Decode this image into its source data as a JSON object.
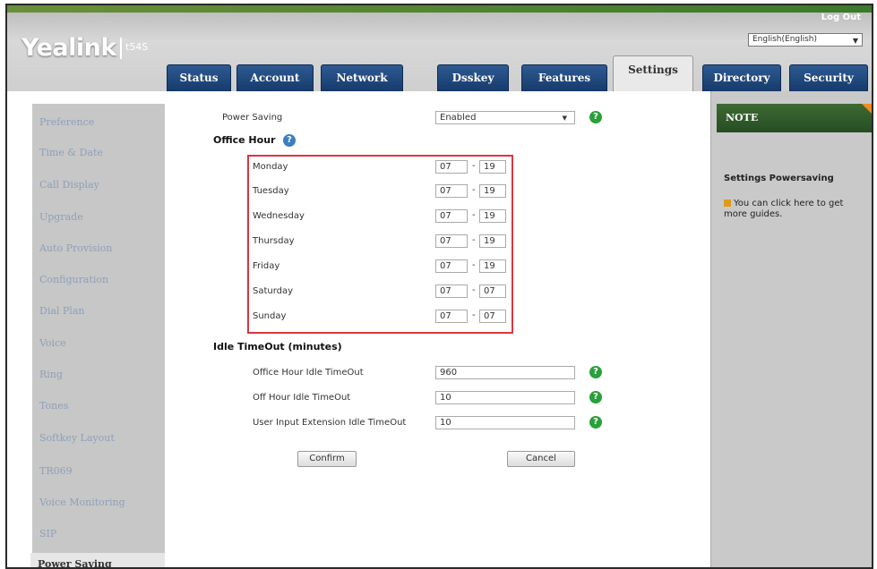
{
  "header": {
    "logo": "Yealink",
    "model": "t54S",
    "logout": "Log Out",
    "language": "English(English)"
  },
  "tabs": [
    {
      "label": "Status"
    },
    {
      "label": "Account"
    },
    {
      "label": "Network"
    },
    {
      "label": "Dsskey"
    },
    {
      "label": "Features"
    },
    {
      "label": "Settings",
      "active": true
    },
    {
      "label": "Directory"
    },
    {
      "label": "Security"
    }
  ],
  "sidebar": {
    "items": [
      {
        "label": "Preference"
      },
      {
        "label": "Time & Date"
      },
      {
        "label": "Call Display"
      },
      {
        "label": "Upgrade"
      },
      {
        "label": "Auto Provision"
      },
      {
        "label": "Configuration"
      },
      {
        "label": "Dial Plan"
      },
      {
        "label": "Voice"
      },
      {
        "label": "Ring"
      },
      {
        "label": "Tones"
      },
      {
        "label": "Softkey Layout"
      },
      {
        "label": "TR069"
      },
      {
        "label": "Voice Monitoring"
      },
      {
        "label": "SIP"
      },
      {
        "label": "Power Saving",
        "active": true
      }
    ]
  },
  "main": {
    "power_saving_label": "Power Saving",
    "power_saving_value": "Enabled",
    "office_hour_heading": "Office Hour",
    "days": [
      {
        "label": "Monday",
        "start": "07",
        "end": "19"
      },
      {
        "label": "Tuesday",
        "start": "07",
        "end": "19"
      },
      {
        "label": "Wednesday",
        "start": "07",
        "end": "19"
      },
      {
        "label": "Thursday",
        "start": "07",
        "end": "19"
      },
      {
        "label": "Friday",
        "start": "07",
        "end": "19"
      },
      {
        "label": "Saturday",
        "start": "07",
        "end": "07"
      },
      {
        "label": "Sunday",
        "start": "07",
        "end": "07"
      }
    ],
    "dash": "-",
    "idle_heading": "Idle TimeOut (minutes)",
    "idle_rows": [
      {
        "label": "Office Hour Idle TimeOut",
        "value": "960"
      },
      {
        "label": "Off Hour Idle TimeOut",
        "value": "10"
      },
      {
        "label": "User Input Extension Idle TimeOut",
        "value": "10"
      }
    ],
    "confirm_label": "Confirm",
    "cancel_label": "Cancel"
  },
  "note": {
    "heading": "NOTE",
    "title": "Settings Powersaving",
    "text": "You can click here to get more guides."
  },
  "colors": {
    "tab_blue": "#1f4a82",
    "note_green": "#2f5a2b",
    "highlight_red": "#d9363e",
    "help_green": "#2aa03a"
  }
}
